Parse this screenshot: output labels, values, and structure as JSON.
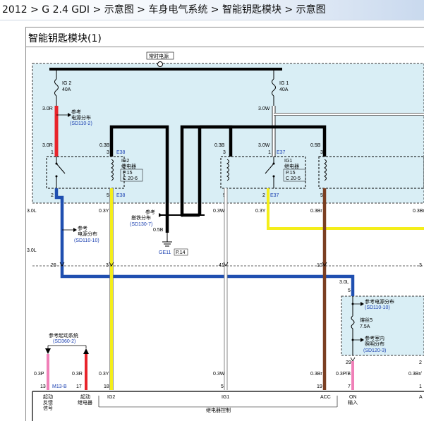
{
  "breadcrumb": [
    "2012",
    "G 2.4 GDI",
    "示意图",
    "车身电气系统",
    "智能钥匙模块",
    "示意图"
  ],
  "breadcrumb_sep": " > ",
  "panel_title": "智能钥匙模块(1)",
  "hot_label": "常时电源",
  "fuses": [
    {
      "name": "IG 2",
      "rating": "40A"
    },
    {
      "name": "IG 1",
      "rating": "40A"
    }
  ],
  "refs": {
    "power_dist_top": {
      "label1": "参考",
      "label2": "电源分布",
      "code": "(SD110-2)"
    },
    "power_dist_left": {
      "label1": "参考",
      "label2": "电源分布",
      "code": "(SD110-10)"
    },
    "ground_dist": {
      "label1": "参考",
      "label2": "搭铁分布",
      "code": "(SD130-7)"
    },
    "power_dist_right": {
      "label": "参考电源分布",
      "code": "(SD110-10)"
    },
    "interior_light": {
      "label1": "参考室内",
      "label2": "照明分布",
      "code": "(SD120-3)"
    },
    "start_system": {
      "label": "参考起动系统",
      "code": "(SD360-2)"
    }
  },
  "relays": [
    {
      "name": "IG2",
      "type": "继电器",
      "page": "P.15",
      "pos": "C 20-6"
    },
    {
      "name": "IG1",
      "type": "继电器",
      "page": "P.15",
      "pos": "C 20-5"
    }
  ],
  "connectors": {
    "e38": "E38",
    "e37": "E37",
    "ge11": "GE11",
    "p14": "P.14",
    "m13b": "M13-B"
  },
  "wires": {
    "w3_0r_a": "3.0R",
    "w3_0r_b": "3.0R",
    "w0_3b_a": "0.3B",
    "w0_3b_b": "0.3B",
    "w3_0w_a": "3.0W",
    "w3_0w_b": "3.0W",
    "w0_5b": "0.5B",
    "w0_5b_gnd": "0.5B",
    "w3_0l_a": "3.0L",
    "w3_0l_b": "3.0L",
    "w3_0l_c": "3.0L",
    "w3_0l_d": "3.0L",
    "w0_3y_a": "0.3Y",
    "w0_3y_b": "0.3Y",
    "w0_3y_c": "0.3Y",
    "w0_3w_a": "0.3W",
    "w0_3w_b": "0.3W",
    "w0_3br_a": "0.3Br",
    "w0_3br_b": "0.3Br",
    "w0_3br_c": "0.3Br/",
    "w0_3p": "0.3P",
    "w0_3r": "0.3R",
    "w0_3pb": "0.3P/B"
  },
  "pins": {
    "p1a": "1",
    "p3a": "3",
    "p3b": "3",
    "p1b": "1",
    "p3c": "3",
    "p2a": "2",
    "p5a": "5",
    "p5b": "5",
    "p2b": "2",
    "p5c": "5",
    "p26": "26",
    "p3d": "3",
    "p41": "41",
    "p10": "10",
    "p3e": "3",
    "p5d": "5",
    "p29": "29",
    "p2c": "2",
    "p13": "13",
    "p17": "17",
    "p18": "18",
    "p5e": "5",
    "p1c": "1",
    "p19": "19",
    "p7": "7"
  },
  "fuse5": {
    "name": "熔丝5",
    "rating": "7.5A"
  },
  "bottom_labels": {
    "start_feedback": [
      "起动",
      "反馈",
      "信号"
    ],
    "start_relay": [
      "起动",
      "继电器"
    ],
    "ig2": "IG2",
    "ig1": "IG1",
    "acc": "ACC",
    "on_input": [
      "ON",
      "输入"
    ],
    "a_cut": "A",
    "relay_control": "继电器控制"
  },
  "colors": {
    "red": "#e8242b",
    "blue": "#1f4fb0",
    "yellow": "#f4ee1a",
    "brown": "#7b3f22",
    "pink": "#f080b8",
    "black": "#000000",
    "white": "#ffffff",
    "grey": "#9a9a9a",
    "panel_bg": "#d9eef5",
    "label_blue": "#1a3fb0"
  }
}
